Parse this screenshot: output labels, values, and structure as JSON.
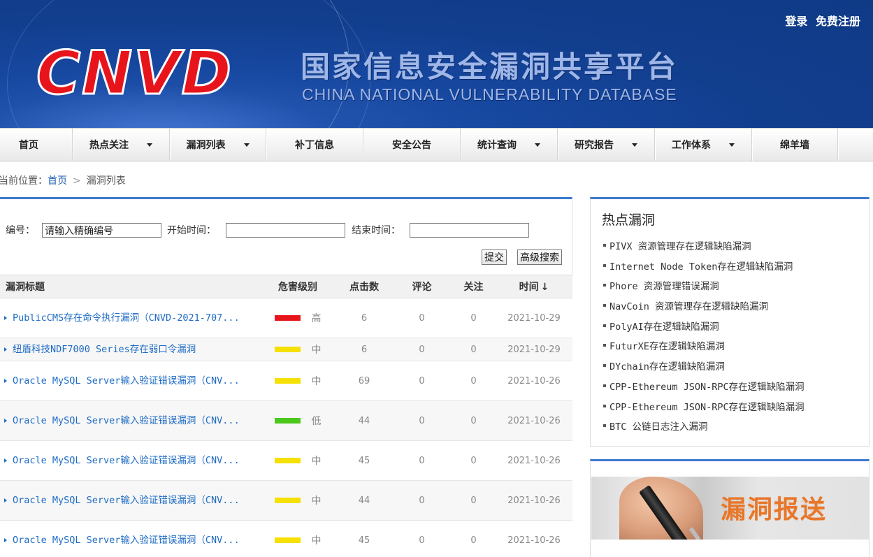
{
  "header": {
    "logo": "CNVD",
    "title_cn": "国家信息安全漏洞共享平台",
    "title_en": "CHINA NATIONAL VULNERABILITY DATABASE",
    "login": "登录",
    "register": "免费注册"
  },
  "nav": [
    {
      "label": "首页",
      "dropdown": false
    },
    {
      "label": "热点关注",
      "dropdown": true
    },
    {
      "label": "漏洞列表",
      "dropdown": true
    },
    {
      "label": "补丁信息",
      "dropdown": false
    },
    {
      "label": "安全公告",
      "dropdown": false
    },
    {
      "label": "统计查询",
      "dropdown": true
    },
    {
      "label": "研究报告",
      "dropdown": true
    },
    {
      "label": "工作体系",
      "dropdown": true
    },
    {
      "label": "绵羊墙",
      "dropdown": false
    }
  ],
  "breadcrumb": {
    "prefix": "当前位置：",
    "home": "首页",
    "separator": ">",
    "current": "漏洞列表"
  },
  "search": {
    "id_label": "编号：",
    "id_value": "请输入精确编号",
    "start_label": "开始时间：",
    "start_value": "",
    "end_label": "结束时间：",
    "end_value": "",
    "submit": "提交",
    "advanced": "高级搜索"
  },
  "table": {
    "headers": {
      "title": "漏洞标题",
      "severity": "危害级别",
      "clicks": "点击数",
      "comments": "评论",
      "follows": "关注",
      "time": "时间"
    },
    "sort_icon": "arrow-down-icon",
    "rows": [
      {
        "title": "PublicCMS存在命令执行漏洞（CNVD-2021-707...",
        "severity": "高",
        "severity_color": "#e8141c",
        "clicks": "6",
        "comments": "0",
        "follows": "0",
        "time": "2021-10-29"
      },
      {
        "title": "纽盾科技NDF7000 Series存在弱口令漏洞",
        "severity": "中",
        "severity_color": "#f5e000",
        "clicks": "6",
        "comments": "0",
        "follows": "0",
        "time": "2021-10-29"
      },
      {
        "title": "Oracle MySQL Server输入验证错误漏洞（CNV...",
        "severity": "中",
        "severity_color": "#f5e000",
        "clicks": "69",
        "comments": "0",
        "follows": "0",
        "time": "2021-10-26"
      },
      {
        "title": "Oracle MySQL Server输入验证错误漏洞（CNV...",
        "severity": "低",
        "severity_color": "#4cc81c",
        "clicks": "44",
        "comments": "0",
        "follows": "0",
        "time": "2021-10-26"
      },
      {
        "title": "Oracle MySQL Server输入验证错误漏洞（CNV...",
        "severity": "中",
        "severity_color": "#f5e000",
        "clicks": "45",
        "comments": "0",
        "follows": "0",
        "time": "2021-10-26"
      },
      {
        "title": "Oracle MySQL Server输入验证错误漏洞（CNV...",
        "severity": "中",
        "severity_color": "#f5e000",
        "clicks": "44",
        "comments": "0",
        "follows": "0",
        "time": "2021-10-26"
      },
      {
        "title": "Oracle MySQL Server输入验证错误漏洞（CNV...",
        "severity": "中",
        "severity_color": "#f5e000",
        "clicks": "45",
        "comments": "0",
        "follows": "0",
        "time": "2021-10-26"
      }
    ]
  },
  "hot": {
    "title": "热点漏洞",
    "items": [
      "PIVX 资源管理存在逻辑缺陷漏洞",
      "Internet Node Token存在逻辑缺陷漏洞",
      "Phore 资源管理错误漏洞",
      "NavCoin 资源管理存在逻辑缺陷漏洞",
      "PolyAI存在逻辑缺陷漏洞",
      "FuturXE存在逻辑缺陷漏洞",
      "DYchain存在逻辑缺陷漏洞",
      "CPP-Ethereum JSON-RPC存在逻辑缺陷漏洞",
      "CPP-Ethereum JSON-RPC存在逻辑缺陷漏洞",
      "BTC 公链日志注入漏洞"
    ]
  },
  "banner": {
    "text": "漏洞报送"
  },
  "colors": {
    "brand_blue": "#3b7ad0",
    "link": "#1e6bc4",
    "logo_red": "#e8141c"
  }
}
